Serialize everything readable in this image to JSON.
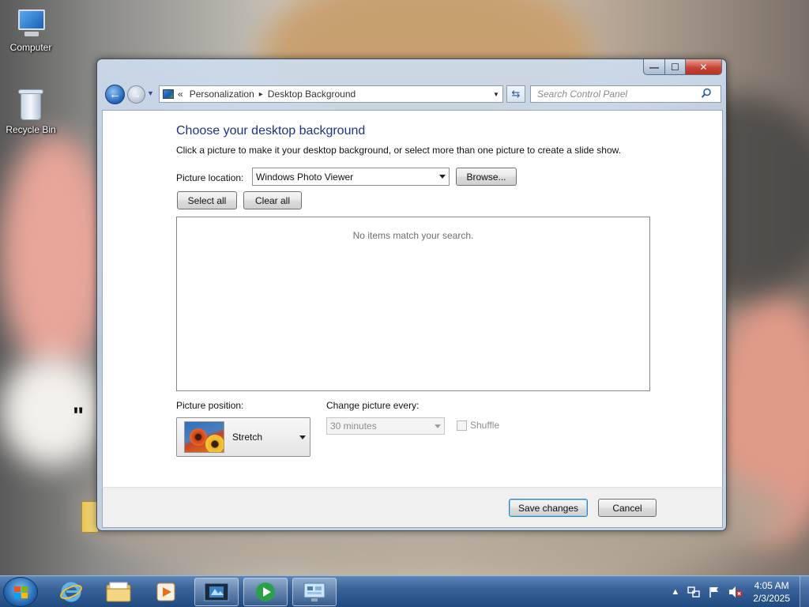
{
  "desktop": {
    "icons": [
      {
        "label": "Computer"
      },
      {
        "label": "Recycle Bin"
      },
      {
        "label": ""
      }
    ],
    "stray_text": "\""
  },
  "window": {
    "controls": {
      "minimize": "—",
      "maximize": "☐",
      "close": "✕"
    },
    "breadcrumb": {
      "overflow": "«",
      "items": [
        "Personalization",
        "Desktop Background"
      ],
      "separator": "▸"
    },
    "search": {
      "placeholder": "Search Control Panel"
    },
    "heading": "Choose your desktop background",
    "description": "Click a picture to make it your desktop background, or select more than one picture to create a slide show.",
    "picture_location": {
      "label": "Picture location:",
      "value": "Windows Photo Viewer"
    },
    "browse_label": "Browse...",
    "select_all_label": "Select all",
    "clear_all_label": "Clear all",
    "gallery_empty_text": "No items match your search.",
    "picture_position": {
      "label": "Picture position:",
      "value": "Stretch"
    },
    "change_picture": {
      "label": "Change picture every:",
      "value": "30 minutes",
      "disabled": true
    },
    "shuffle": {
      "label": "Shuffle",
      "checked": false,
      "disabled": true
    },
    "save_label": "Save changes",
    "cancel_label": "Cancel"
  },
  "taskbar": {
    "apps": [
      "start-menu",
      "internet-explorer",
      "windows-explorer",
      "media-player",
      "movie-maker",
      "media-center",
      "control-panel"
    ],
    "active_app": "control-panel",
    "tray": {
      "show_hidden": "▲",
      "time": "4:05 AM",
      "date": "2/3/2025"
    }
  },
  "colors": {
    "heading": "#1e3287",
    "taskbar": "#1f4a80",
    "close_button": "#c9453a"
  }
}
